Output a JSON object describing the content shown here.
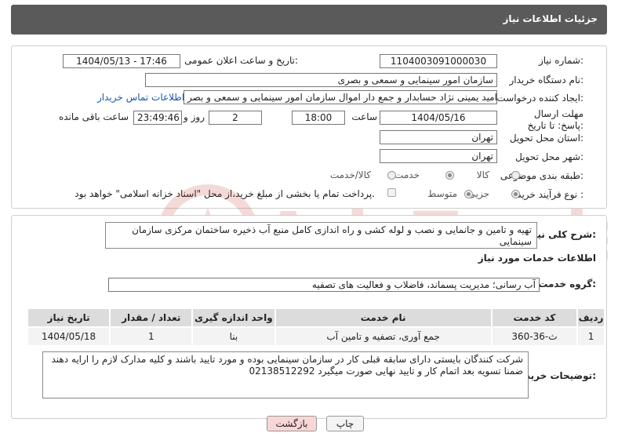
{
  "header": {
    "title": "جزئیات اطلاعات نیاز"
  },
  "fields": {
    "need_number_label": "شماره نیاز:",
    "need_number": "1104003091000030",
    "announce_label": "تاریخ و ساعت اعلان عمومی:",
    "announce_value": "1404/05/13 - 17:46",
    "buyer_org_label": "نام دستگاه خریدار:",
    "buyer_org": "سازمان امور سینمایی و سمعی و بصری",
    "creator_label": "ایجاد کننده درخواست:",
    "creator": "امید یمینی نژاد حسابدار و جمع دار اموال سازمان امور سینمایی و سمعی و بصر",
    "contact_link": "اطلاعات تماس خریدار",
    "deadline_label": "مهلت ارسال پاسخ: تا تاریخ:",
    "deadline_date": "1404/05/16",
    "time_label": "ساعت",
    "deadline_time": "18:00",
    "days_value": "2",
    "days_label": "روز و",
    "remaining_time": "23:49:46",
    "remaining_label": "ساعت باقی مانده",
    "province_label": "استان محل تحویل:",
    "province": "تهران",
    "city_label": "شهر محل تحویل:",
    "city": "تهران",
    "category_label": "طبقه بندی موضوعی:",
    "category_options": [
      "کالا",
      "خدمت",
      "کالا/خدمت"
    ],
    "category_selected": "خدمت",
    "process_label": "نوع فرآیند خرید :",
    "process_options": [
      "جزیی",
      "متوسط"
    ],
    "process_selected": "جزیی",
    "payment_note": "پرداخت تمام یا بخشی از مبلغ خرید،از محل \"اسناد خزانه اسلامی\" خواهد بود."
  },
  "summary": {
    "label": "شرح کلی نیاز:",
    "text": "تهیه و تامین و جانمایی و نصب و لوله کشی و راه اندازی کامل منبع آب ذخیره ساختمان مرکزی سازمان سینمایی"
  },
  "services": {
    "section_title": "اطلاعات خدمات مورد نیاز",
    "group_label": "گروه خدمت:",
    "group_value": "آب رسانی؛ مدیریت پسماند، فاضلاب و فعالیت های تصفیه",
    "columns": [
      "ردیف",
      "کد خدمت",
      "نام خدمت",
      "واحد اندازه گیری",
      "تعداد / مقدار",
      "تاریخ نیاز"
    ],
    "rows": [
      [
        "1",
        "ث-36-360",
        "جمع آوری، تصفیه و تامین آب",
        "بنا",
        "1",
        "1404/05/18"
      ]
    ]
  },
  "buyer_notes": {
    "label": "توضیحات خریدار:",
    "text": "شرکت کنندگان بایستی دارای سابقه قبلی کار در سازمان سینمایی بوده و مورد تایید باشند و کلیه مدارک لازم را ارایه دهند ضمنا تسویه بعد اتمام کار و تایید نهایی صورت میگیرد 02138512292"
  },
  "buttons": {
    "print": "چاپ",
    "back": "بازگشت"
  },
  "watermark": "AriaTender.neT",
  "colors": {
    "header_bg": "#5a5a5a",
    "link": "#1a56b0",
    "back_button_bg": "#f9d6d6",
    "watermark": "#c0392b"
  }
}
